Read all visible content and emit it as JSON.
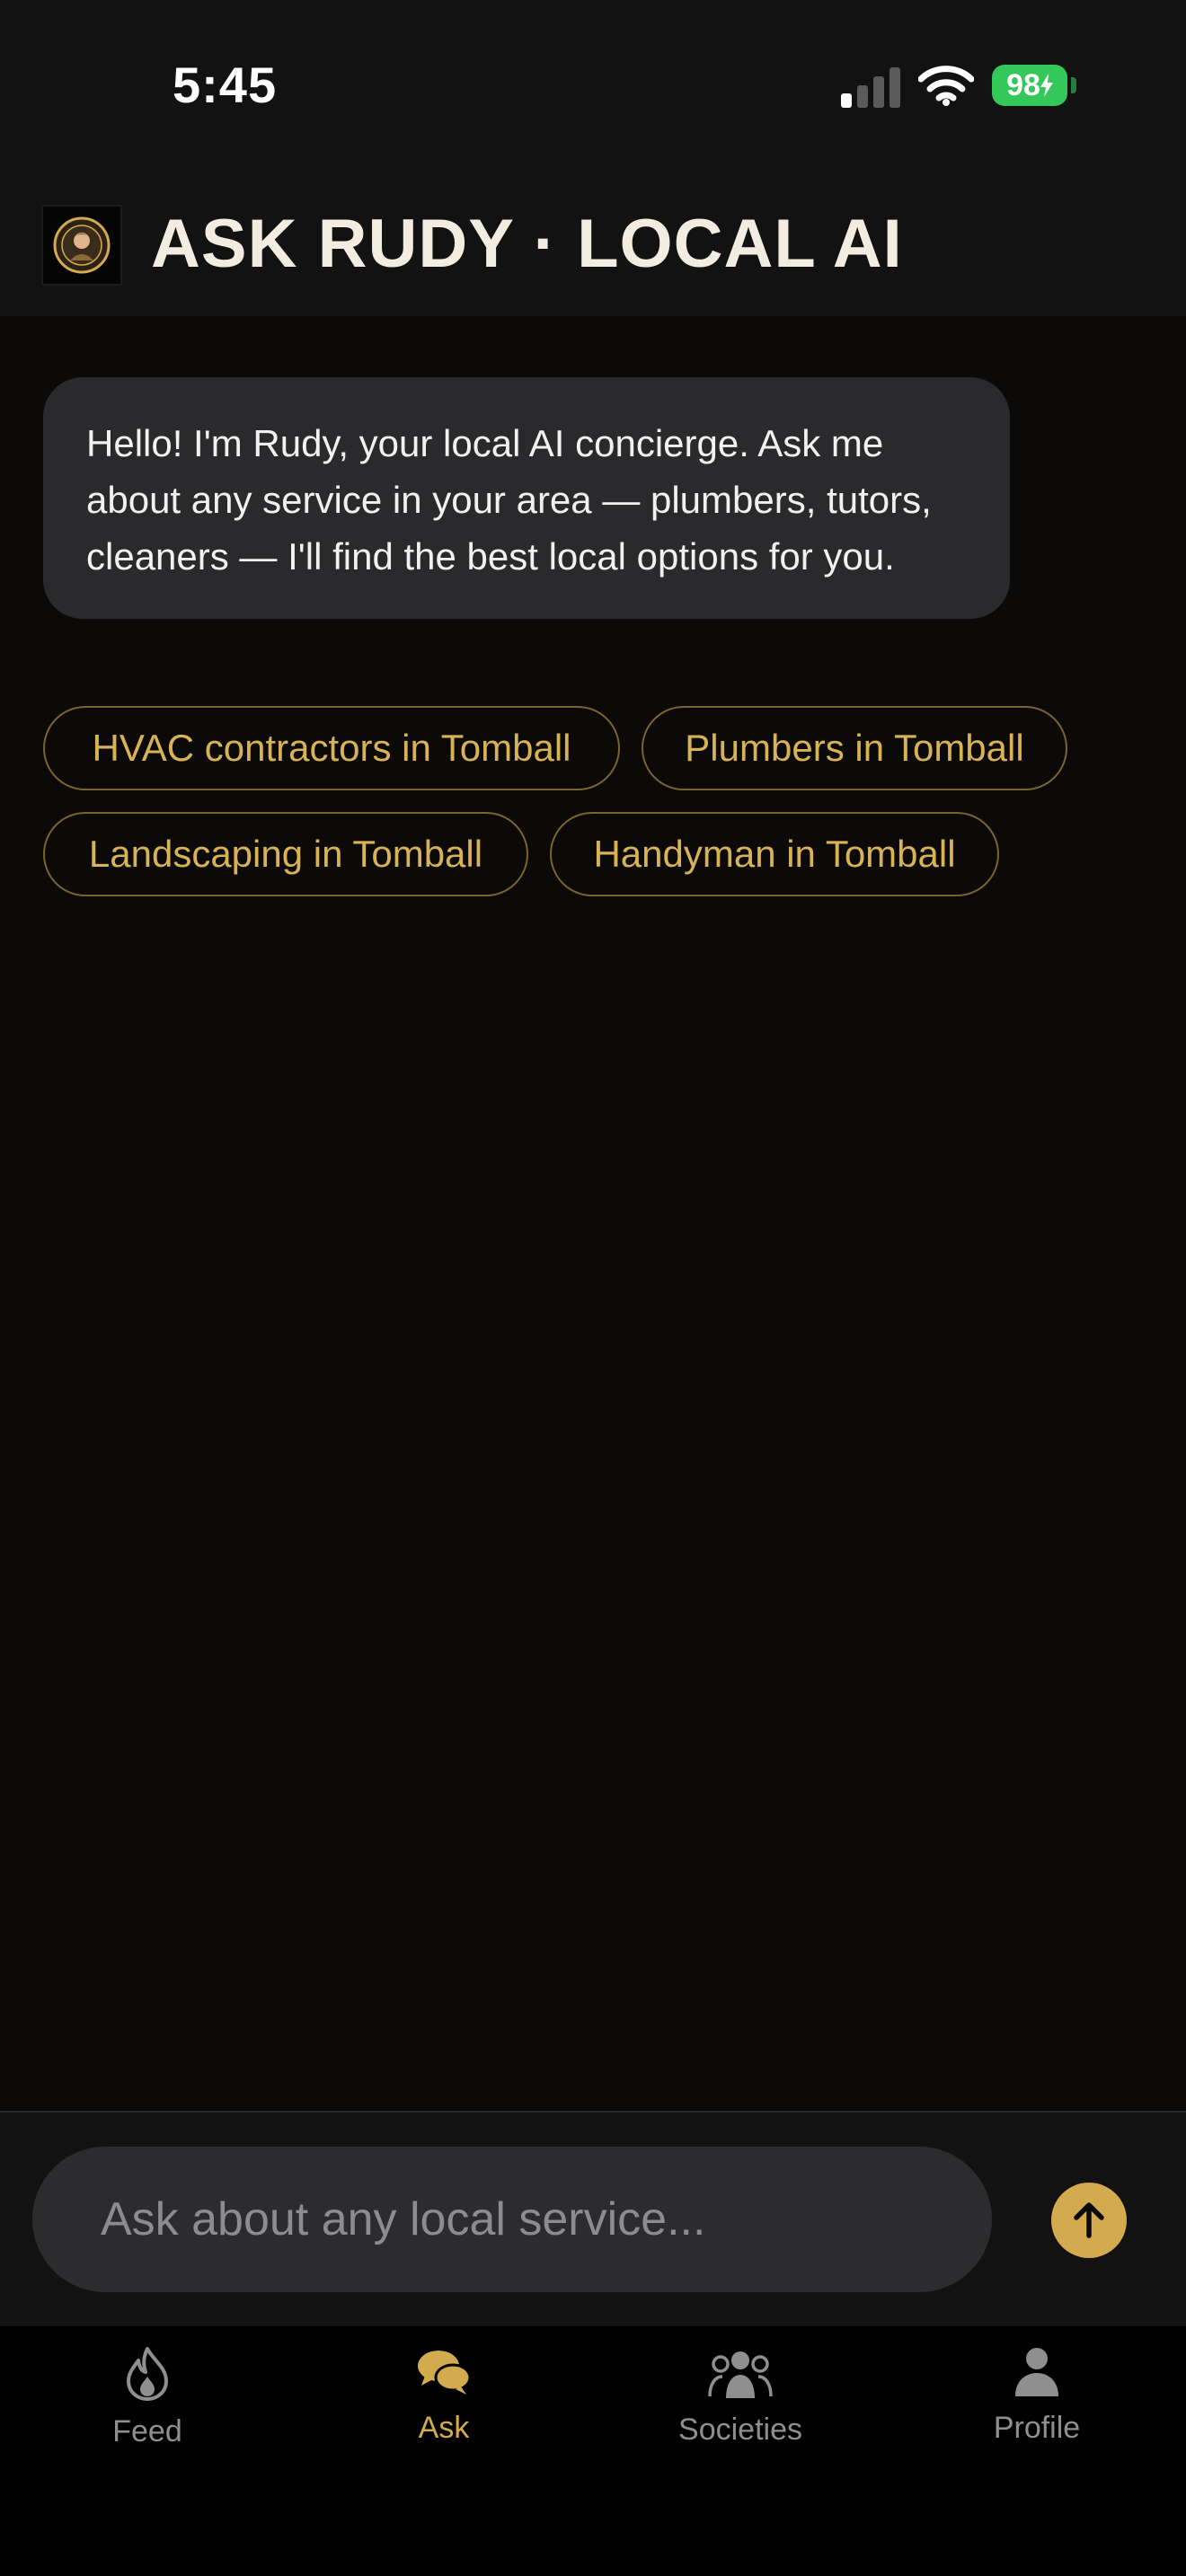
{
  "status_bar": {
    "time": "5:45",
    "battery": "98",
    "icons": [
      "cellular-signal-icon",
      "wifi-icon",
      "battery-charging-icon"
    ]
  },
  "header": {
    "title": "ASK RUDY · LOCAL AI",
    "avatar_icon": "rudy-avatar-icon"
  },
  "chat": {
    "greeting": "Hello! I'm Rudy, your local AI concierge. Ask me about any service in your area — plumbers, tutors, cleaners — I'll find the best local options for you."
  },
  "suggestions": [
    "HVAC contractors in Tomball",
    "Plumbers in Tomball",
    "Landscaping in Tomball",
    "Handyman in Tomball"
  ],
  "composer": {
    "placeholder": "Ask about any local service...",
    "send_icon": "arrow-up-icon"
  },
  "tabs": [
    {
      "label": "Feed",
      "icon": "flame-icon",
      "active": false
    },
    {
      "label": "Ask",
      "icon": "chat-bubbles-icon",
      "active": true
    },
    {
      "label": "Societies",
      "icon": "group-icon",
      "active": false
    },
    {
      "label": "Profile",
      "icon": "person-icon",
      "active": false
    }
  ],
  "colors": {
    "accent": "#d4aa4e",
    "background": "#0b0a09",
    "bubble": "#2a2a2c",
    "battery": "#34c759"
  }
}
